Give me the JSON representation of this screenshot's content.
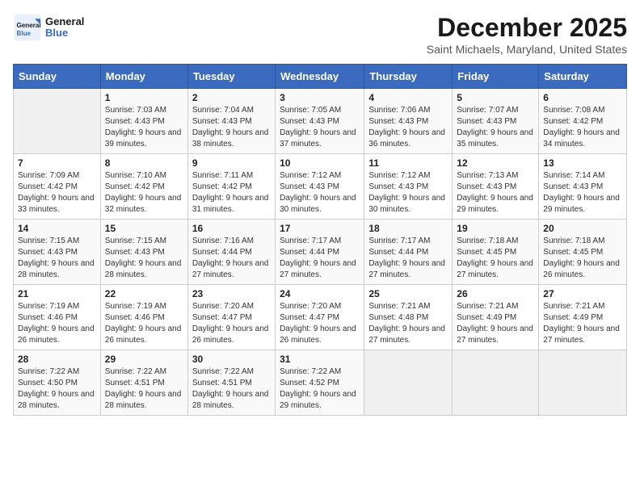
{
  "logo": {
    "text_general": "General",
    "text_blue": "Blue"
  },
  "title": "December 2025",
  "location": "Saint Michaels, Maryland, United States",
  "days_of_week": [
    "Sunday",
    "Monday",
    "Tuesday",
    "Wednesday",
    "Thursday",
    "Friday",
    "Saturday"
  ],
  "weeks": [
    [
      {
        "day": "",
        "sunrise": "",
        "sunset": "",
        "daylight": ""
      },
      {
        "day": "1",
        "sunrise": "Sunrise: 7:03 AM",
        "sunset": "Sunset: 4:43 PM",
        "daylight": "Daylight: 9 hours and 39 minutes."
      },
      {
        "day": "2",
        "sunrise": "Sunrise: 7:04 AM",
        "sunset": "Sunset: 4:43 PM",
        "daylight": "Daylight: 9 hours and 38 minutes."
      },
      {
        "day": "3",
        "sunrise": "Sunrise: 7:05 AM",
        "sunset": "Sunset: 4:43 PM",
        "daylight": "Daylight: 9 hours and 37 minutes."
      },
      {
        "day": "4",
        "sunrise": "Sunrise: 7:06 AM",
        "sunset": "Sunset: 4:43 PM",
        "daylight": "Daylight: 9 hours and 36 minutes."
      },
      {
        "day": "5",
        "sunrise": "Sunrise: 7:07 AM",
        "sunset": "Sunset: 4:43 PM",
        "daylight": "Daylight: 9 hours and 35 minutes."
      },
      {
        "day": "6",
        "sunrise": "Sunrise: 7:08 AM",
        "sunset": "Sunset: 4:42 PM",
        "daylight": "Daylight: 9 hours and 34 minutes."
      }
    ],
    [
      {
        "day": "7",
        "sunrise": "Sunrise: 7:09 AM",
        "sunset": "Sunset: 4:42 PM",
        "daylight": "Daylight: 9 hours and 33 minutes."
      },
      {
        "day": "8",
        "sunrise": "Sunrise: 7:10 AM",
        "sunset": "Sunset: 4:42 PM",
        "daylight": "Daylight: 9 hours and 32 minutes."
      },
      {
        "day": "9",
        "sunrise": "Sunrise: 7:11 AM",
        "sunset": "Sunset: 4:42 PM",
        "daylight": "Daylight: 9 hours and 31 minutes."
      },
      {
        "day": "10",
        "sunrise": "Sunrise: 7:12 AM",
        "sunset": "Sunset: 4:43 PM",
        "daylight": "Daylight: 9 hours and 30 minutes."
      },
      {
        "day": "11",
        "sunrise": "Sunrise: 7:12 AM",
        "sunset": "Sunset: 4:43 PM",
        "daylight": "Daylight: 9 hours and 30 minutes."
      },
      {
        "day": "12",
        "sunrise": "Sunrise: 7:13 AM",
        "sunset": "Sunset: 4:43 PM",
        "daylight": "Daylight: 9 hours and 29 minutes."
      },
      {
        "day": "13",
        "sunrise": "Sunrise: 7:14 AM",
        "sunset": "Sunset: 4:43 PM",
        "daylight": "Daylight: 9 hours and 29 minutes."
      }
    ],
    [
      {
        "day": "14",
        "sunrise": "Sunrise: 7:15 AM",
        "sunset": "Sunset: 4:43 PM",
        "daylight": "Daylight: 9 hours and 28 minutes."
      },
      {
        "day": "15",
        "sunrise": "Sunrise: 7:15 AM",
        "sunset": "Sunset: 4:43 PM",
        "daylight": "Daylight: 9 hours and 28 minutes."
      },
      {
        "day": "16",
        "sunrise": "Sunrise: 7:16 AM",
        "sunset": "Sunset: 4:44 PM",
        "daylight": "Daylight: 9 hours and 27 minutes."
      },
      {
        "day": "17",
        "sunrise": "Sunrise: 7:17 AM",
        "sunset": "Sunset: 4:44 PM",
        "daylight": "Daylight: 9 hours and 27 minutes."
      },
      {
        "day": "18",
        "sunrise": "Sunrise: 7:17 AM",
        "sunset": "Sunset: 4:44 PM",
        "daylight": "Daylight: 9 hours and 27 minutes."
      },
      {
        "day": "19",
        "sunrise": "Sunrise: 7:18 AM",
        "sunset": "Sunset: 4:45 PM",
        "daylight": "Daylight: 9 hours and 27 minutes."
      },
      {
        "day": "20",
        "sunrise": "Sunrise: 7:18 AM",
        "sunset": "Sunset: 4:45 PM",
        "daylight": "Daylight: 9 hours and 26 minutes."
      }
    ],
    [
      {
        "day": "21",
        "sunrise": "Sunrise: 7:19 AM",
        "sunset": "Sunset: 4:46 PM",
        "daylight": "Daylight: 9 hours and 26 minutes."
      },
      {
        "day": "22",
        "sunrise": "Sunrise: 7:19 AM",
        "sunset": "Sunset: 4:46 PM",
        "daylight": "Daylight: 9 hours and 26 minutes."
      },
      {
        "day": "23",
        "sunrise": "Sunrise: 7:20 AM",
        "sunset": "Sunset: 4:47 PM",
        "daylight": "Daylight: 9 hours and 26 minutes."
      },
      {
        "day": "24",
        "sunrise": "Sunrise: 7:20 AM",
        "sunset": "Sunset: 4:47 PM",
        "daylight": "Daylight: 9 hours and 26 minutes."
      },
      {
        "day": "25",
        "sunrise": "Sunrise: 7:21 AM",
        "sunset": "Sunset: 4:48 PM",
        "daylight": "Daylight: 9 hours and 27 minutes."
      },
      {
        "day": "26",
        "sunrise": "Sunrise: 7:21 AM",
        "sunset": "Sunset: 4:49 PM",
        "daylight": "Daylight: 9 hours and 27 minutes."
      },
      {
        "day": "27",
        "sunrise": "Sunrise: 7:21 AM",
        "sunset": "Sunset: 4:49 PM",
        "daylight": "Daylight: 9 hours and 27 minutes."
      }
    ],
    [
      {
        "day": "28",
        "sunrise": "Sunrise: 7:22 AM",
        "sunset": "Sunset: 4:50 PM",
        "daylight": "Daylight: 9 hours and 28 minutes."
      },
      {
        "day": "29",
        "sunrise": "Sunrise: 7:22 AM",
        "sunset": "Sunset: 4:51 PM",
        "daylight": "Daylight: 9 hours and 28 minutes."
      },
      {
        "day": "30",
        "sunrise": "Sunrise: 7:22 AM",
        "sunset": "Sunset: 4:51 PM",
        "daylight": "Daylight: 9 hours and 28 minutes."
      },
      {
        "day": "31",
        "sunrise": "Sunrise: 7:22 AM",
        "sunset": "Sunset: 4:52 PM",
        "daylight": "Daylight: 9 hours and 29 minutes."
      },
      {
        "day": "",
        "sunrise": "",
        "sunset": "",
        "daylight": ""
      },
      {
        "day": "",
        "sunrise": "",
        "sunset": "",
        "daylight": ""
      },
      {
        "day": "",
        "sunrise": "",
        "sunset": "",
        "daylight": ""
      }
    ]
  ]
}
